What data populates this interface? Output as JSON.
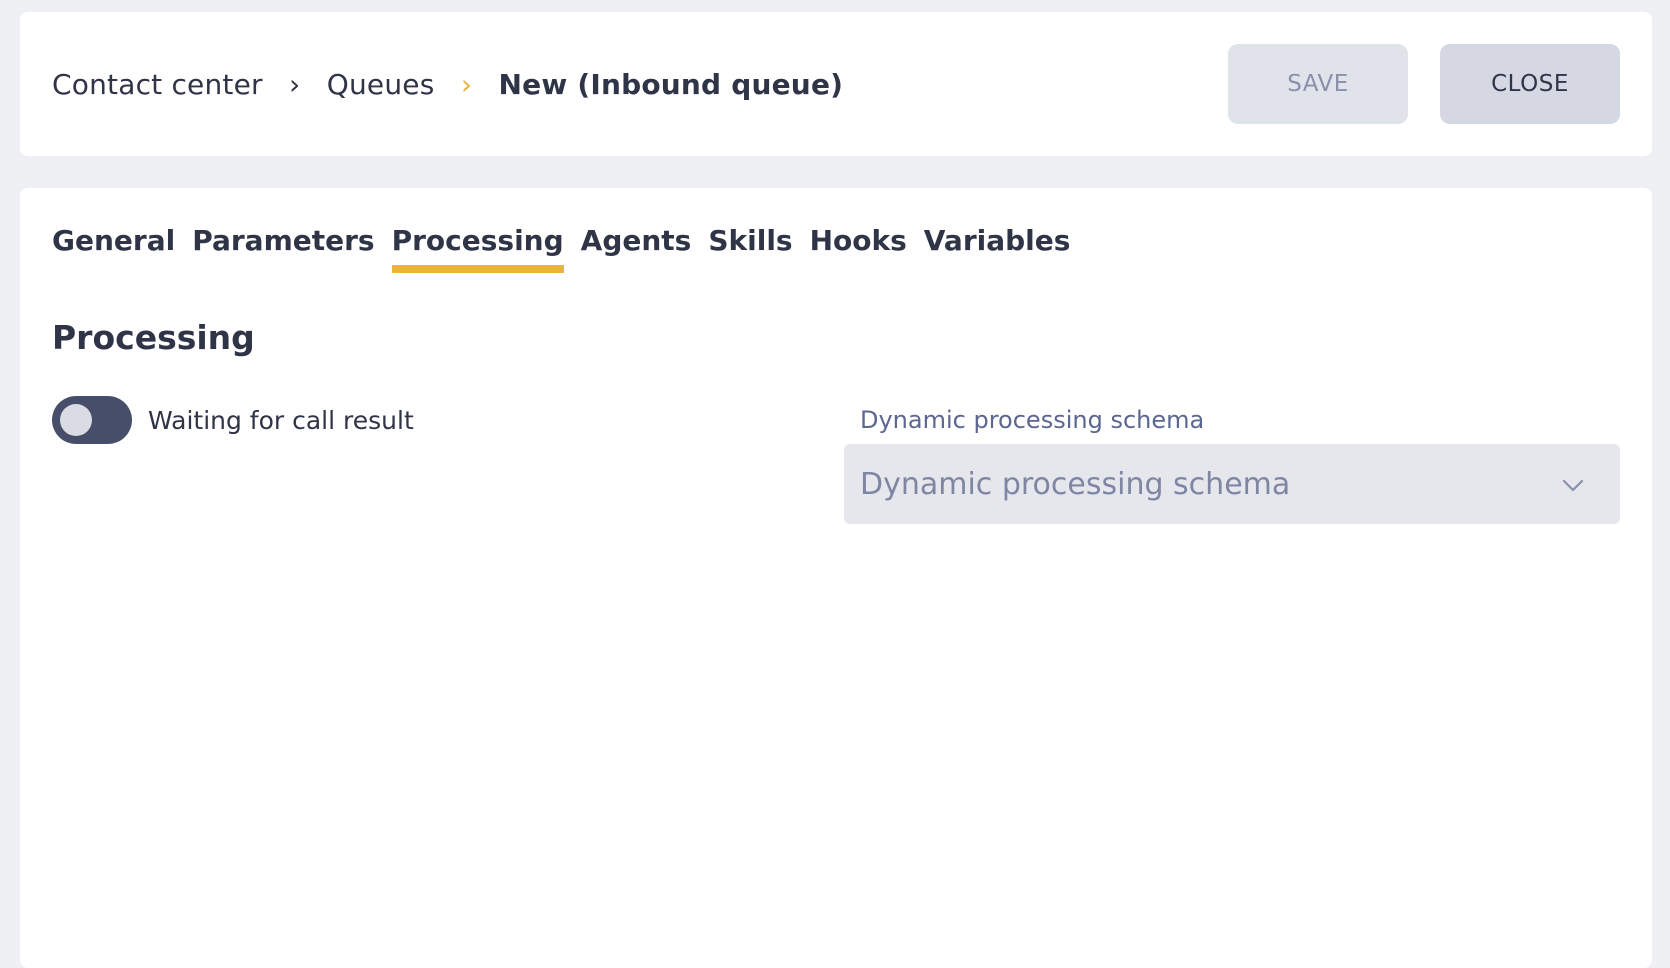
{
  "breadcrumb": {
    "items": [
      "Contact center",
      "Queues",
      "New (Inbound queue)"
    ],
    "separator": "›"
  },
  "header": {
    "save_label": "SAVE",
    "close_label": "CLOSE"
  },
  "tabs": [
    {
      "label": "General",
      "active": false
    },
    {
      "label": "Parameters",
      "active": false
    },
    {
      "label": "Processing",
      "active": true
    },
    {
      "label": "Agents",
      "active": false
    },
    {
      "label": "Skills",
      "active": false
    },
    {
      "label": "Hooks",
      "active": false
    },
    {
      "label": "Variables",
      "active": false
    }
  ],
  "processing": {
    "title": "Processing",
    "toggle_label": "Waiting for call result",
    "schema_field_label": "Dynamic processing schema",
    "schema_placeholder": "Dynamic processing schema"
  },
  "colors": {
    "accent": "#e9b43b",
    "background": "#eff0f4",
    "text": "#2f3447",
    "toggle_track": "#474e69"
  },
  "icons": {
    "breadcrumb_separator": "chevron-right-icon",
    "select_arrow": "chevron-down-icon"
  }
}
